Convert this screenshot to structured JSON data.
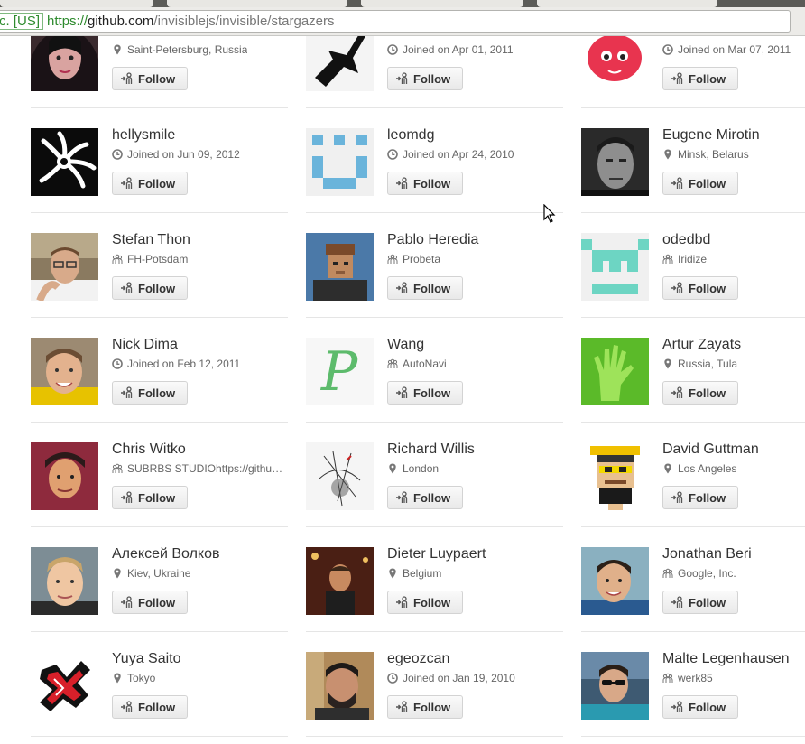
{
  "browser": {
    "ev_badge": "c. [US]",
    "url_scheme": "https://",
    "url_host": "github.com",
    "url_path": "/invisiblejs/invisible/stargazers"
  },
  "follow_label": "Follow",
  "users": [
    {
      "name": "",
      "meta": "Saint-Petersburg, Russia",
      "meta_icon": "location-icon",
      "avatar": "photo-woman"
    },
    {
      "name": "",
      "meta": "Joined on Apr 01, 2011",
      "meta_icon": "clock-icon",
      "avatar": "guitar-silhouette"
    },
    {
      "name": "",
      "meta": "Joined on Mar 07, 2011",
      "meta_icon": "clock-icon",
      "avatar": "pink-fruit-cartoon"
    },
    {
      "name": "hellysmile",
      "meta": "Joined on Jun 09, 2012",
      "meta_icon": "clock-icon",
      "avatar": "tribal-sun-logo"
    },
    {
      "name": "leomdg",
      "meta": "Joined on Apr 24, 2010",
      "meta_icon": "clock-icon",
      "avatar": "identicon-blue"
    },
    {
      "name": "Eugene Mirotin",
      "meta": "Minsk, Belarus",
      "meta_icon": "location-icon",
      "avatar": "photo-bw-man"
    },
    {
      "name": "Stefan Thon",
      "meta": "FH-Potsdam",
      "meta_icon": "organization-icon",
      "avatar": "photo-man-glasses"
    },
    {
      "name": "Pablo Heredia",
      "meta": "Probeta",
      "meta_icon": "organization-icon",
      "avatar": "pixel-man"
    },
    {
      "name": "odedbd",
      "meta": "Iridize",
      "meta_icon": "organization-icon",
      "avatar": "identicon-teal"
    },
    {
      "name": "Nick Dima",
      "meta": "Joined on Feb 12, 2011",
      "meta_icon": "clock-icon",
      "avatar": "photo-man-smiling"
    },
    {
      "name": "Wang",
      "meta": "AutoNavi",
      "meta_icon": "organization-icon",
      "avatar": "letter-p-logo"
    },
    {
      "name": "Artur Zayats",
      "meta": "Russia, Tula",
      "meta_icon": "location-icon",
      "avatar": "green-hand"
    },
    {
      "name": "Chris Witko",
      "meta": "SUBRBS STUDIOhttps://github.com",
      "meta_icon": "organization-icon",
      "avatar": "photo-man-purple"
    },
    {
      "name": "Richard Willis",
      "meta": "London",
      "meta_icon": "location-icon",
      "avatar": "sketch-art"
    },
    {
      "name": "David Guttman",
      "meta": "Los Angeles",
      "meta_icon": "location-icon",
      "avatar": "pixel-man-hat"
    },
    {
      "name": "Алексей Волков",
      "meta": "Kiev, Ukraine",
      "meta_icon": "location-icon",
      "avatar": "photo-man-blond"
    },
    {
      "name": "Dieter Luypaert",
      "meta": "Belgium",
      "meta_icon": "location-icon",
      "avatar": "photo-man-bar"
    },
    {
      "name": "Jonathan Beri",
      "meta": "Google, Inc.",
      "meta_icon": "organization-icon",
      "avatar": "photo-man-blue"
    },
    {
      "name": "Yuya Saito",
      "meta": "Tokyo",
      "meta_icon": "location-icon",
      "avatar": "red-black-logo"
    },
    {
      "name": "egeozcan",
      "meta": "Joined on Jan 19, 2010",
      "meta_icon": "clock-icon",
      "avatar": "photo-man-beard"
    },
    {
      "name": "Malte Legenhausen",
      "meta": "werk85",
      "meta_icon": "organization-icon",
      "avatar": "photo-man-sunglasses"
    }
  ]
}
